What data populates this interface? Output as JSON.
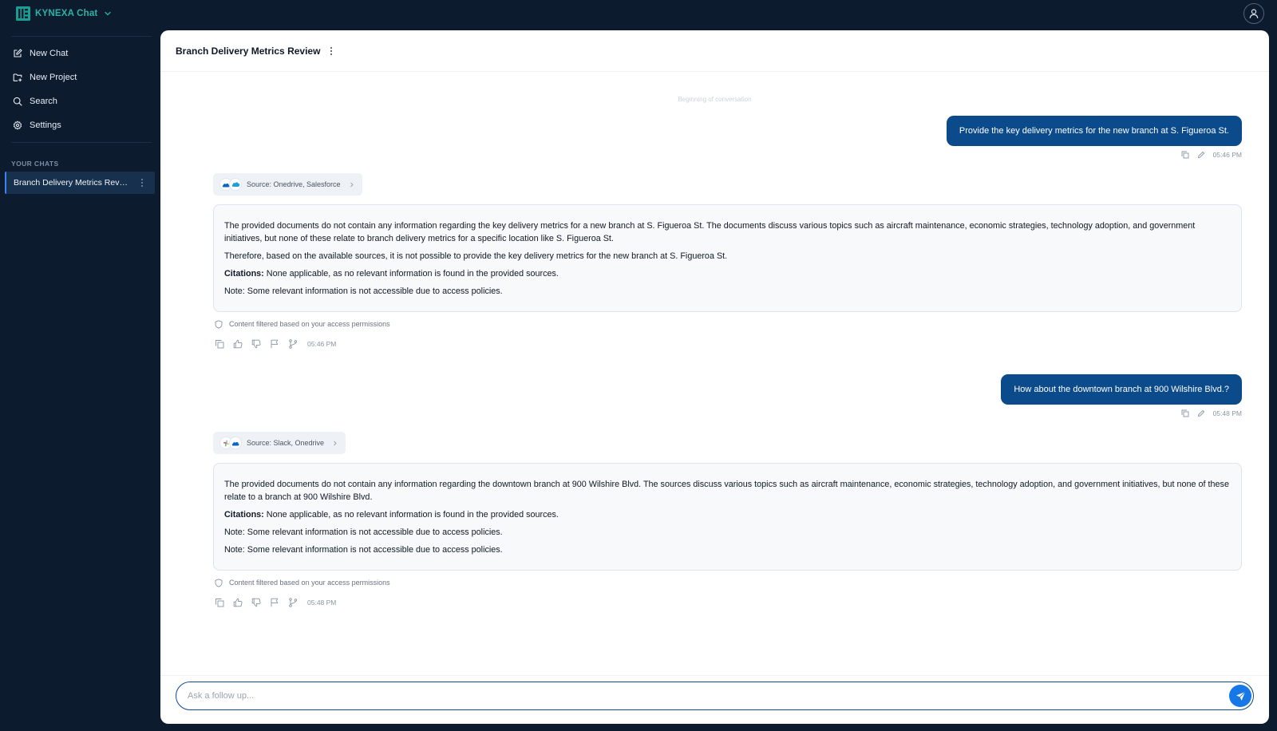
{
  "app": {
    "brand": "KYNEXA Chat",
    "brand_color": "#2bb3a7",
    "accent": "#0b4a8b",
    "icons": {
      "logo": "kynexa-logo-icon",
      "brand_menu": "chevron-down-icon",
      "user": "user-icon"
    }
  },
  "sidebar": {
    "items": [
      {
        "label": "New Chat",
        "icon": "compose-icon"
      },
      {
        "label": "New Project",
        "icon": "folder-plus-icon"
      },
      {
        "label": "Search",
        "icon": "search-icon"
      },
      {
        "label": "Settings",
        "icon": "gear-icon"
      }
    ],
    "section_label": "YOUR CHATS",
    "chats": [
      {
        "label": "Branch Delivery Metrics Review",
        "active": true
      }
    ]
  },
  "conversation": {
    "title": "Branch Delivery Metrics Review",
    "beginning_label": "Beginning of conversation",
    "messages": [
      {
        "role": "user",
        "text": "Provide the key delivery metrics for the new branch at S. Figueroa St.",
        "time": "05:46 PM"
      },
      {
        "role": "assistant",
        "source_label": "Source: Onedrive, Salesforce",
        "source_icons": [
          "onedrive-icon",
          "salesforce-icon"
        ],
        "paragraphs": [
          "The provided documents do not contain any information regarding the key delivery metrics for a new branch at S. Figueroa St. The documents discuss various topics such as aircraft maintenance, economic strategies, technology adoption, and government initiatives, but none of these relate to branch delivery metrics for a specific location like S. Figueroa St.",
          "Therefore, based on the available sources, it is not possible to provide the key delivery metrics for the new branch at S. Figueroa St."
        ],
        "citations_label": "Citations:",
        "citations_text": "None applicable, as no relevant information is found in the provided sources.",
        "notes": [
          "Note: Some relevant information is not accessible due to access policies."
        ],
        "filter_note": "Content filtered based on your access permissions",
        "time": "05:46 PM"
      },
      {
        "role": "user",
        "text": "How about the downtown branch at 900 Wilshire Blvd.?",
        "time": "05:48 PM"
      },
      {
        "role": "assistant",
        "source_label": "Source: Slack, Onedrive",
        "source_icons": [
          "slack-icon",
          "onedrive-icon"
        ],
        "paragraphs": [
          "The provided documents do not contain any information regarding the downtown branch at 900 Wilshire Blvd. The sources discuss various topics such as aircraft maintenance, economic strategies, technology adoption, and government initiatives, but none of these relate to a branch at 900 Wilshire Blvd."
        ],
        "citations_label": "Citations:",
        "citations_text": "None applicable, as no relevant information is found in the provided sources.",
        "notes": [
          "Note: Some relevant information is not accessible due to access policies.",
          "Note: Some relevant information is not accessible due to access policies."
        ],
        "filter_note": "Content filtered based on your access permissions",
        "time": "05:48 PM"
      }
    ]
  },
  "composer": {
    "placeholder": "Ask a follow up...",
    "value": ""
  }
}
